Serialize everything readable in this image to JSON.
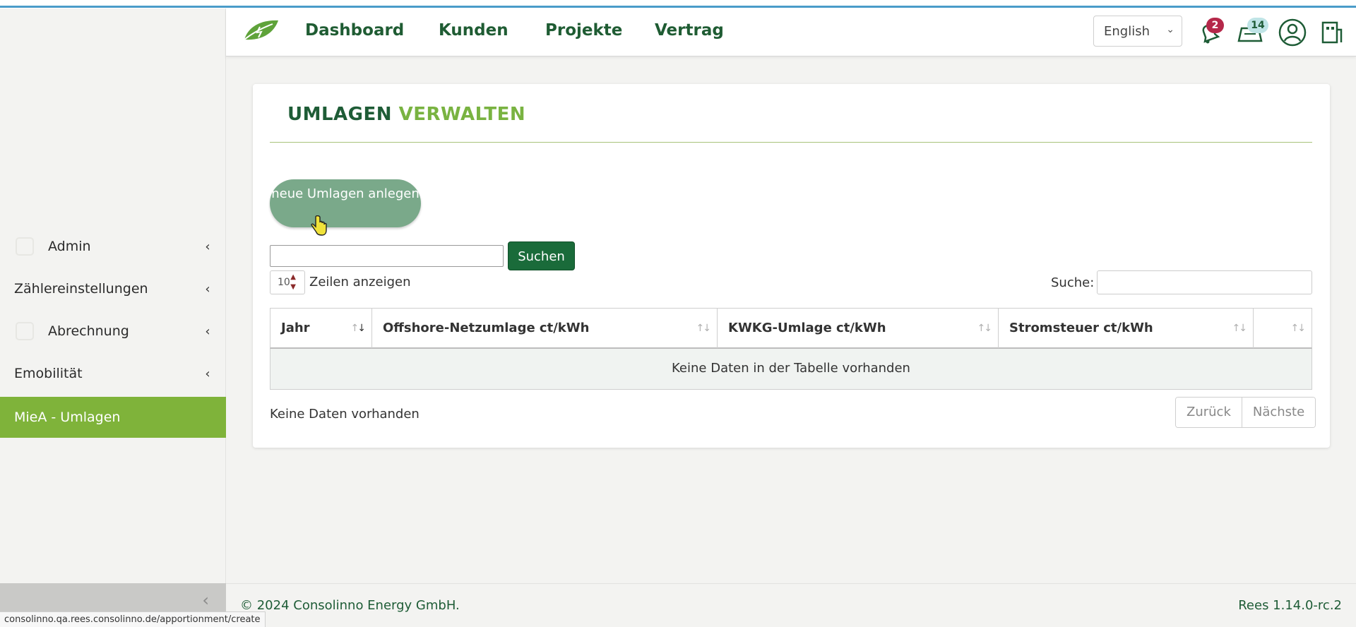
{
  "header": {
    "nav": [
      "Dashboard",
      "Kunden",
      "Projekte",
      "Vertrag"
    ],
    "language": "English",
    "notifications_count": "2",
    "messages_count": "14"
  },
  "sidebar": {
    "items": [
      {
        "label": "Admin",
        "icon": "admin-icon"
      },
      {
        "label": "Zählereinstellungen"
      },
      {
        "label": "Abrechnung",
        "icon": "billing-icon"
      },
      {
        "label": "Emobilität"
      },
      {
        "label": "MieA - Umlagen",
        "active": true
      }
    ],
    "chevron": "‹",
    "collapse": "‹"
  },
  "main": {
    "title_part1": "UMLAGEN",
    "title_part2": "VERWALTEN",
    "new_button": "neue Umlagen anlegen",
    "search_button": "Suchen",
    "page_length": "10",
    "page_length_label": "Zeilen anzeigen",
    "filter_label": "Suche:",
    "table": {
      "columns": [
        "Jahr",
        "Offshore-Netzumlage ct/kWh",
        "KWKG-Umlage ct/kWh",
        "Stromsteuer ct/kWh",
        ""
      ],
      "empty_message": "Keine Daten in der Tabelle vorhanden"
    },
    "info": "Keine Daten vorhanden",
    "pager": {
      "prev": "Zurück",
      "next": "Nächste"
    }
  },
  "footer": {
    "copyright": "© 2024 Consolinno Energy GmbH.",
    "version": "Rees 1.14.0-rc.2"
  },
  "statusbar": {
    "url": "consolinno.qa.rees.consolinno.de/apportionment/create"
  },
  "colors": {
    "brand_dark": "#1e5c36",
    "brand_light": "#7fb33a",
    "primary_button": "#1a6b3a",
    "new_button": "#7aa98a"
  }
}
